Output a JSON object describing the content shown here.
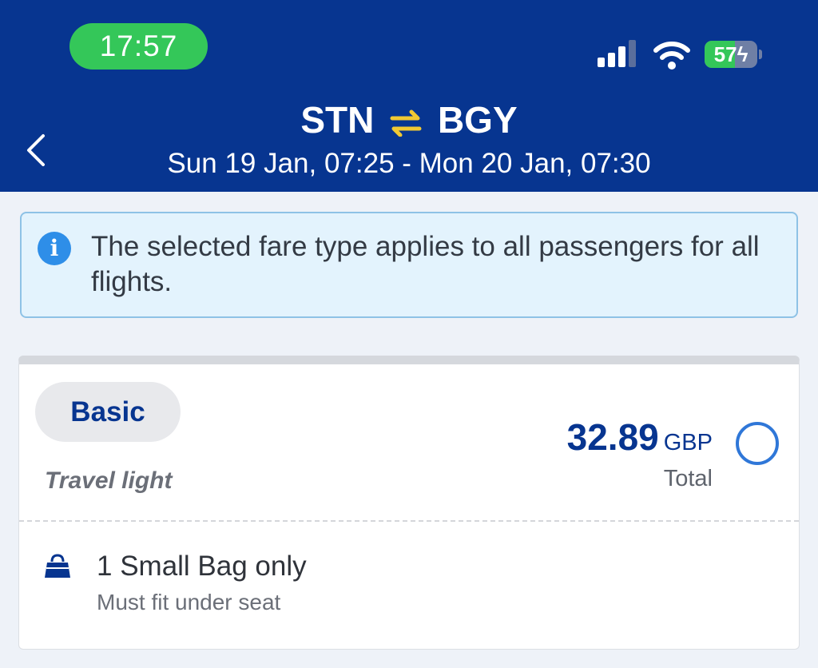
{
  "status_bar": {
    "time": "17:57",
    "battery_percent": "57",
    "battery_level": 0.57,
    "signal_icon": "cellular-signal-icon",
    "wifi_icon": "wifi-icon",
    "battery_icon": "battery-charging-icon"
  },
  "header": {
    "back_icon": "chevron-left-icon",
    "origin": "STN",
    "swap_icon": "swap-arrows-icon",
    "destination": "BGY",
    "dates": "Sun 19 Jan, 07:25 - Mon 20 Jan, 07:30",
    "background_color": "#073590",
    "accent_color": "#f1c933"
  },
  "info_banner": {
    "icon": "info-icon",
    "text": "The selected fare type applies to all passengers for all flights."
  },
  "fare_card": {
    "fare_name": "Basic",
    "tagline": "Travel light",
    "price": "32.89",
    "currency": "GBP",
    "price_caption": "Total",
    "selected": false,
    "features": [
      {
        "icon": "handbag-icon",
        "title": "1 Small Bag only",
        "subtitle": "Must fit under seat"
      }
    ]
  }
}
